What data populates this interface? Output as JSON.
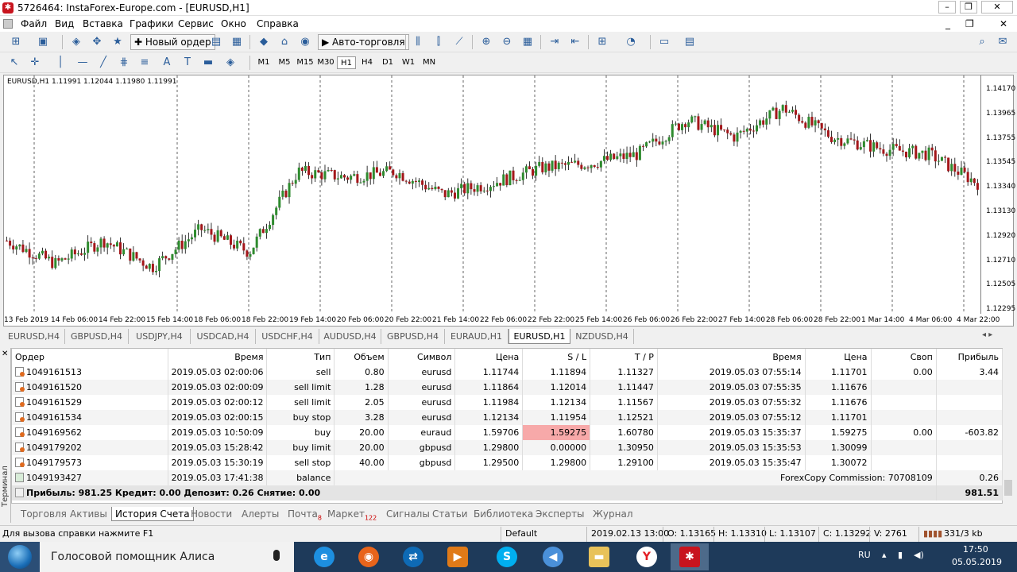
{
  "window": {
    "title": "5726464: InstaForex-Europe.com - [EURUSD,H1]",
    "logo": "instaforex-logo-icon"
  },
  "menu": [
    "Файл",
    "Вид",
    "Вставка",
    "Графики",
    "Сервис",
    "Окно",
    "Справка"
  ],
  "toolbar": {
    "new_order": "Новый ордер",
    "autotrading": "Авто-торговля"
  },
  "timeframes": [
    "M1",
    "M5",
    "M15",
    "M30",
    "H1",
    "H4",
    "D1",
    "W1",
    "MN"
  ],
  "timeframe_selected": "H1",
  "chart": {
    "info": "EURUSD,H1  1.11991 1.12044 1.11980 1.11991",
    "price_labels": [
      "1.14170",
      "1.13965",
      "1.13755",
      "1.13545",
      "1.13340",
      "1.13130",
      "1.12920",
      "1.12710",
      "1.12505",
      "1.12295"
    ],
    "time_labels": [
      "13 Feb 2019",
      "14 Feb 06:00",
      "14 Feb 22:00",
      "15 Feb 14:00",
      "18 Feb 06:00",
      "18 Feb 22:00",
      "19 Feb 14:00",
      "20 Feb 06:00",
      "20 Feb 22:00",
      "21 Feb 14:00",
      "22 Feb 06:00",
      "22 Feb 22:00",
      "25 Feb 14:00",
      "26 Feb 06:00",
      "26 Feb 22:00",
      "27 Feb 14:00",
      "28 Feb 06:00",
      "28 Feb 22:00",
      "1 Mar 14:00",
      "4 Mar 06:00",
      "4 Mar 22:00"
    ]
  },
  "chart_data": {
    "type": "line",
    "title": "EURUSD,H1",
    "ylim": [
      1.12295,
      1.1417
    ],
    "x": [
      "13 Feb 2019",
      "14 Feb 06:00",
      "14 Feb 22:00",
      "15 Feb 14:00",
      "18 Feb 06:00",
      "18 Feb 22:00",
      "19 Feb 14:00",
      "20 Feb 06:00",
      "20 Feb 22:00",
      "21 Feb 14:00",
      "22 Feb 06:00",
      "22 Feb 22:00",
      "25 Feb 14:00",
      "26 Feb 06:00",
      "26 Feb 22:00",
      "27 Feb 14:00",
      "28 Feb 06:00",
      "28 Feb 22:00",
      "1 Mar 14:00",
      "4 Mar 06:00",
      "4 Mar 22:00"
    ],
    "series": [
      {
        "values": [
          1.1285,
          1.1265,
          1.1285,
          1.1262,
          1.1295,
          1.1275,
          1.1345,
          1.134,
          1.1345,
          1.1325,
          1.1335,
          1.1348,
          1.1352,
          1.136,
          1.139,
          1.1375,
          1.14,
          1.1375,
          1.1365,
          1.136,
          1.1335
        ]
      }
    ]
  },
  "chart_tabs": [
    "EURUSD,H4",
    "GBPUSD,H4",
    "USDJPY,H4",
    "USDCAD,H4",
    "USDCHF,H4",
    "AUDUSD,H4",
    "GBPUSD,H4",
    "EURAUD,H1",
    "EURUSD,H1",
    "NZDUSD,H4"
  ],
  "chart_tab_active": "EURUSD,H1",
  "terminal": {
    "side_label": "Терминал",
    "columns": [
      "Ордер",
      "Время",
      "Тип",
      "Объем",
      "Символ",
      "Цена",
      "S / L",
      "T / P",
      "Время",
      "Цена",
      "Своп",
      "Прибыль"
    ],
    "rows": [
      [
        "1049161513",
        "2019.05.03 02:00:06",
        "sell",
        "0.80",
        "eurusd",
        "1.11744",
        "1.11894",
        "1.11327",
        "2019.05.03 07:55:14",
        "1.11701",
        "0.00",
        "3.44"
      ],
      [
        "1049161520",
        "2019.05.03 02:00:09",
        "sell limit",
        "1.28",
        "eurusd",
        "1.11864",
        "1.12014",
        "1.11447",
        "2019.05.03 07:55:35",
        "1.11676",
        "",
        ""
      ],
      [
        "1049161529",
        "2019.05.03 02:00:12",
        "sell limit",
        "2.05",
        "eurusd",
        "1.11984",
        "1.12134",
        "1.11567",
        "2019.05.03 07:55:32",
        "1.11676",
        "",
        ""
      ],
      [
        "1049161534",
        "2019.05.03 02:00:15",
        "buy stop",
        "3.28",
        "eurusd",
        "1.12134",
        "1.11954",
        "1.12521",
        "2019.05.03 07:55:12",
        "1.11701",
        "",
        ""
      ],
      [
        "1049169562",
        "2019.05.03 10:50:09",
        "buy",
        "20.00",
        "euraud",
        "1.59706",
        "1.59275",
        "1.60780",
        "2019.05.03 15:35:37",
        "1.59275",
        "0.00",
        "-603.82"
      ],
      [
        "1049179202",
        "2019.05.03 15:28:42",
        "buy limit",
        "20.00",
        "gbpusd",
        "1.29800",
        "0.00000",
        "1.30950",
        "2019.05.03 15:35:53",
        "1.30099",
        "",
        ""
      ],
      [
        "1049179573",
        "2019.05.03 15:30:19",
        "sell stop",
        "40.00",
        "gbpusd",
        "1.29500",
        "1.29800",
        "1.29100",
        "2019.05.03 15:35:47",
        "1.30072",
        "",
        ""
      ]
    ],
    "balance_row": {
      "order": "1049193427",
      "time": "2019.05.03 17:41:38",
      "type": "balance",
      "comment": "ForexCopy Commission: 70708109",
      "profit": "0.26"
    },
    "total": {
      "label": "Прибыль: 981.25  Кредит: 0.00  Депозит: 0.26  Снятие: 0.00",
      "value": "981.51"
    }
  },
  "terminal_tabs": [
    {
      "label": "Торговля"
    },
    {
      "label": "Активы"
    },
    {
      "label": "История Счета"
    },
    {
      "label": "Новости"
    },
    {
      "label": "Алерты"
    },
    {
      "label": "Почта",
      "badge": "8"
    },
    {
      "label": "Маркет",
      "badge": "122"
    },
    {
      "label": "Сигналы"
    },
    {
      "label": "Статьи"
    },
    {
      "label": "Библиотека"
    },
    {
      "label": "Эксперты"
    },
    {
      "label": "Журнал"
    }
  ],
  "terminal_tab_active": "История Счета",
  "status": {
    "help": "Для вызова справки нажмите F1",
    "profile": "Default",
    "time": "2019.02.13 13:00",
    "o": "O: 1.13165",
    "h": "H: 1.13310",
    "l": "L: 1.13107",
    "c": "C: 1.13292",
    "v": "V: 2761",
    "traffic": "331/3 kb"
  },
  "taskbar": {
    "search": "Голосовой помощник Алиса",
    "lang": "RU",
    "time": "17:50",
    "date": "05.05.2019"
  }
}
